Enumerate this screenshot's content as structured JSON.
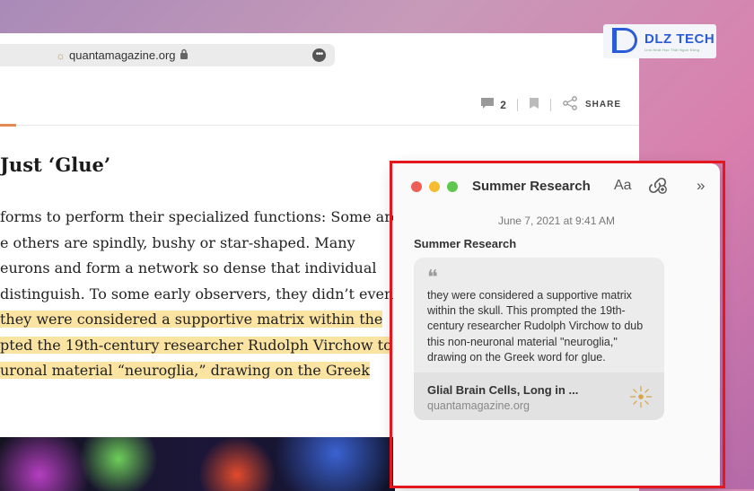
{
  "browser": {
    "url_host": "quantamagazine.org",
    "toolbar": {
      "comment_count": "2",
      "share_label": "SHARE"
    },
    "headline": "Just ‘Glue’",
    "article_lines": [
      {
        "text": "forms to perform their specialized functions: Some are",
        "highlight": false
      },
      {
        "text": "e others are spindly, bushy or star-shaped. Many",
        "highlight": false
      },
      {
        "text": "eurons and form a network so dense that individual",
        "highlight": false
      },
      {
        "text": " distinguish. To some early observers, they didn’t even",
        "highlight": false
      },
      {
        "text": " they were considered a supportive matrix within the",
        "highlight": true
      },
      {
        "text": "pted the 19th-century researcher Rudolph Virchow to",
        "highlight": true
      },
      {
        "text": "uronal material “neuroglia,” drawing on the Greek",
        "highlight": true
      }
    ]
  },
  "logo": {
    "text": "DLZ TECH",
    "tagline": "Link Nhất Học Thật Ngon Đúng"
  },
  "notes": {
    "window_title": "Summer Research",
    "format_label": "Aa",
    "date": "June 7, 2021 at 9:41 AM",
    "note_heading": "Summer Research",
    "quote_mark": "❝",
    "quote_text": "they were considered a supportive matrix within the skull. This prompted the 19th-century researcher Rudolph Virchow to dub this non-neuronal material \"neuroglia,\" drawing on the Greek word for glue.",
    "link": {
      "title": "Glial Brain Cells, Long in ...",
      "url": "quantamagazine.org"
    },
    "icons": [
      "close-icon",
      "minimize-icon",
      "zoom-icon",
      "collaborate-icon",
      "expand-chevrons-icon"
    ]
  },
  "colors": {
    "highlight": "#fbe3a2",
    "frame": "#e3171d",
    "traffic_red": "#ee5f58",
    "traffic_yellow": "#f5bd2f",
    "traffic_green": "#5fc64f"
  }
}
